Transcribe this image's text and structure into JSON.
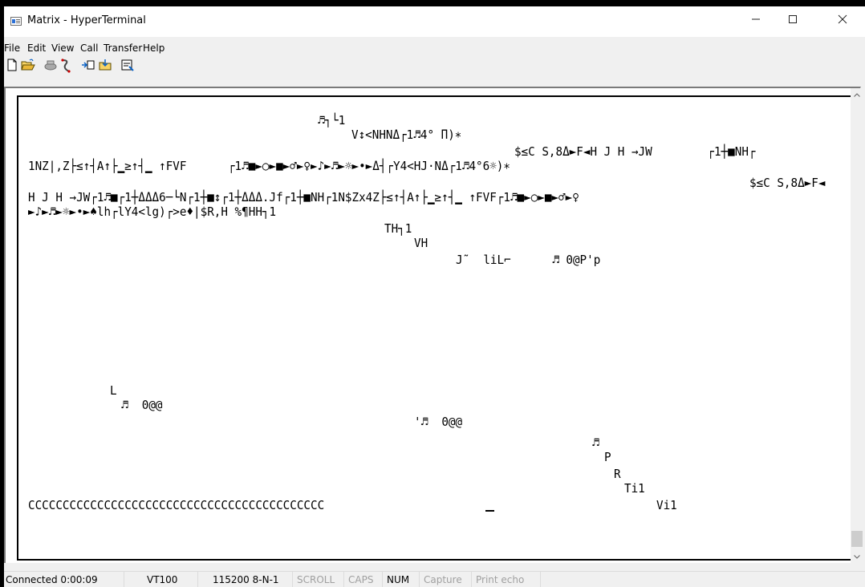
{
  "window": {
    "title": "Matrix - HyperTerminal",
    "controls": {
      "minimize_icon": "minimize-icon",
      "maximize_icon": "maximize-icon",
      "close_icon": "close-icon"
    }
  },
  "menu": [
    "File",
    "Edit",
    "View",
    "Call",
    "Transfer",
    "Help"
  ],
  "toolbar": [
    "new-document-icon",
    "open-folder-icon",
    "dial-phone-icon",
    "disconnect-icon",
    "send-file-icon",
    "receive-file-icon",
    "properties-icon"
  ],
  "terminal": {
    "lines": [
      "♬┐└1",
      "V↕<NHNΔ┌1♬4° Π)∗",
      "$≤C S,8Δ►F◄H J H →JW        ┌1┼■NH┌",
      "1NZ|,Z├≤↑┤A↑├▁≥↑┤▁ ↑FVF      ┌1♬■►○►■►♂►♀►♪►♬►☼►•►Δ┤┌Y4<HJ·NΔ┌1♬4°6☼)∗",
      "$≤C S,8Δ►F◄",
      "H J H →JW┌1♬■┌1┼ΔΔΔ6─└N┌1┼■↕┌1┼ΔΔΔ.Jf┌1┼■NH┌1N$Zx4Z├≤↑┤A↑├▁≥↑┤▁ ↑FVF┌1♬■►○►■►♂►♀",
      "►♪►♬►☼►•►♠lh┌lY4<lg)┌>e♦|$R,H %¶HH┐1",
      "TH┐1",
      "VH",
      "J˜  liL⌐      ♬ 0@P'p",
      "L",
      "♬  0@@",
      "'♬  0@@",
      "♬",
      "P",
      "R",
      "Ti1",
      "CCCCCCCCCCCCCCCCCCCCCCCCCCCCCCCCCCCCCCCCCCC",
      "Vi1"
    ]
  },
  "status": {
    "connected": "Connected 0:00:09",
    "emulation": "VT100",
    "port_settings": "115200 8-N-1",
    "scroll": "SCROLL",
    "caps": "CAPS",
    "num": "NUM",
    "capture": "Capture",
    "print_echo": "Print echo"
  }
}
